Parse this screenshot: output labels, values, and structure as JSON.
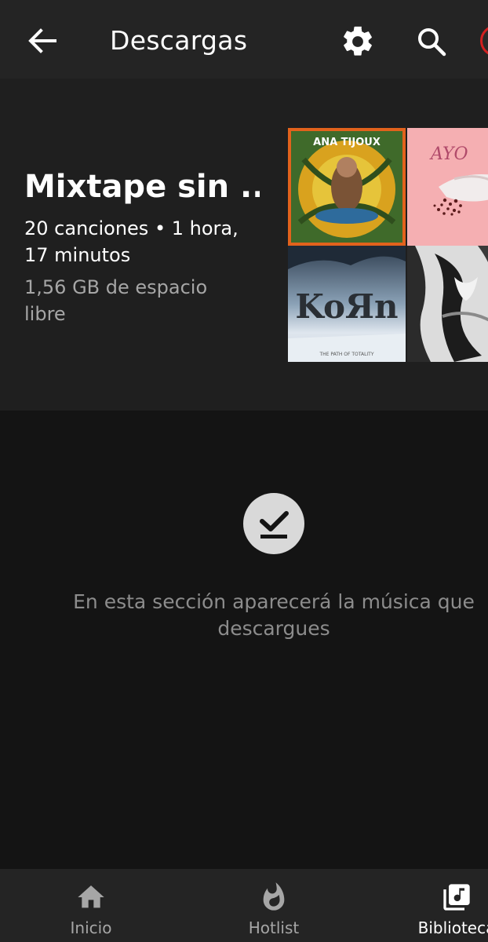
{
  "topbar": {
    "title": "Descargas",
    "back_icon": "arrow-left-icon",
    "settings_icon": "gear-icon",
    "search_icon": "search-icon",
    "avatar_border_color": "#d32020"
  },
  "header": {
    "playlist_title": "Mixtape sin ...",
    "meta": "20 canciones • 1 hora, 17 minutos",
    "storage": "1,56 GB de espacio libre",
    "cover_text": {
      "c1": "ANA TIJOUX",
      "c2": "AYO",
      "c3": "KoЯn",
      "c3_sub": "THE PATH OF TOTALITY"
    }
  },
  "empty_state": {
    "icon": "download-done-icon",
    "message": "En esta sección aparecerá la música que descargues"
  },
  "bottom_nav": {
    "items": [
      {
        "label": "Inicio",
        "icon": "home-icon",
        "active": false
      },
      {
        "label": "Hotlist",
        "icon": "flame-icon",
        "active": false
      },
      {
        "label": "Biblioteca",
        "icon": "library-music-icon",
        "active": true
      }
    ]
  },
  "colors": {
    "background": "#141414",
    "bar": "#242424",
    "card": "#1f1f1f",
    "secondary_text": "#a6a6a6",
    "empty_text": "#8c8c8c"
  }
}
